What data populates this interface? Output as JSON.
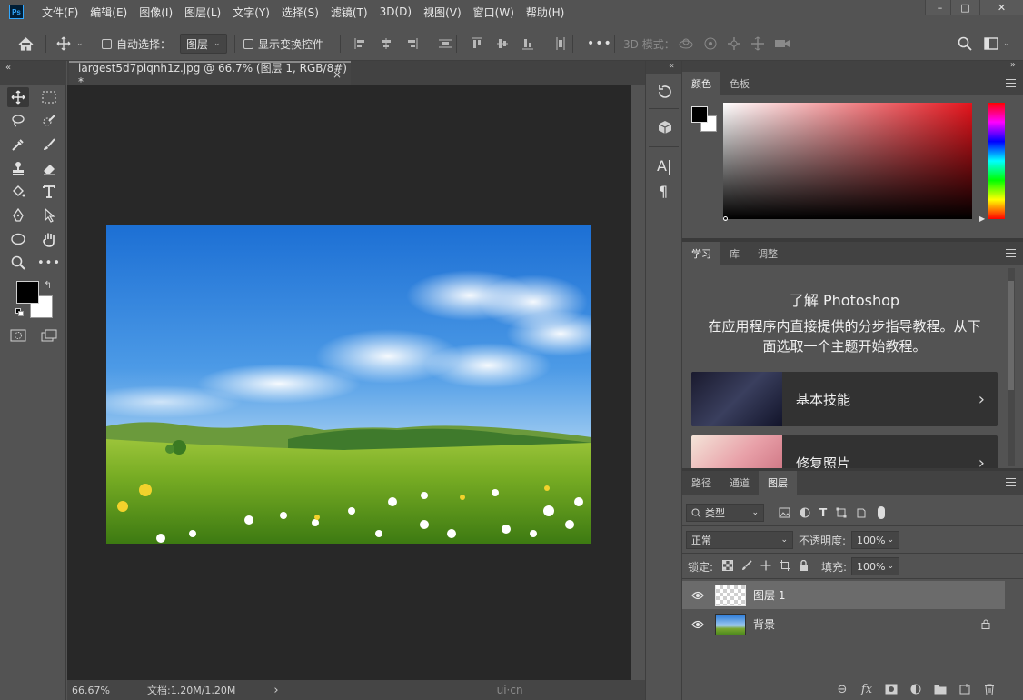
{
  "app": {
    "logo": "Ps"
  },
  "menu": [
    "文件(F)",
    "编辑(E)",
    "图像(I)",
    "图层(L)",
    "文字(Y)",
    "选择(S)",
    "滤镜(T)",
    "3D(D)",
    "视图(V)",
    "窗口(W)",
    "帮助(H)"
  ],
  "window_controls": {
    "minimize": "–",
    "maximize": "□",
    "close": "✕"
  },
  "options": {
    "auto_select_label": "自动选择：",
    "auto_select_value": "图层",
    "show_transform_label": "显示变换控件",
    "more": "•••",
    "mode3d_label": "3D 模式："
  },
  "document": {
    "tab_title": "largest5d7plqnh1z.jpg @ 66.7% (图层 1, RGB/8#) *",
    "close": "×"
  },
  "status": {
    "zoom": "66.67%",
    "doc_info": "文档:1.20M/1.20M",
    "arrow": "›",
    "watermark": "ui·cn"
  },
  "panel_collapse": "«",
  "panel_expand": "»",
  "color_panel": {
    "tabs": [
      "颜色",
      "色板"
    ],
    "active": 0
  },
  "learn_panel": {
    "tabs": [
      "学习",
      "库",
      "调整"
    ],
    "active": 0,
    "title": "了解 Photoshop",
    "description": "在应用程序内直接提供的分步指导教程。从下面选取一个主题开始教程。",
    "lessons": [
      {
        "title": "基本技能"
      },
      {
        "title": "修复照片"
      }
    ],
    "chevron": "›"
  },
  "layers_panel": {
    "tabs": [
      "路径",
      "通道",
      "图层"
    ],
    "active": 2,
    "filter_label": "类型",
    "blend_mode": "正常",
    "opacity_label": "不透明度:",
    "opacity_value": "100%",
    "lock_label": "锁定:",
    "fill_label": "填充:",
    "fill_value": "100%",
    "layers": [
      {
        "name": "图层 1",
        "selected": true,
        "locked": false
      },
      {
        "name": "背景",
        "selected": false,
        "locked": true
      }
    ]
  },
  "colors": {
    "accent": "#31a8ff",
    "bg": "#535353",
    "canvas": "#282828",
    "panel_dark": "#424242"
  }
}
